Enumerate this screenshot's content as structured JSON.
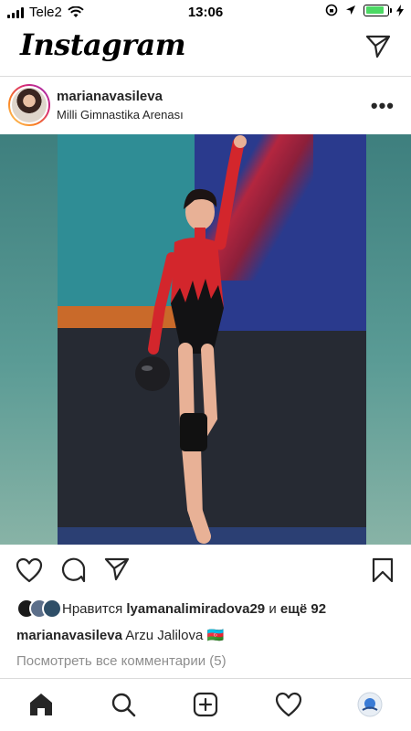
{
  "status_bar": {
    "carrier": "Tele2",
    "time": "13:06",
    "battery_level": 0.85,
    "battery_color": "#4cd964"
  },
  "header": {
    "app_title": "Instagram",
    "dm_icon": "paper-plane-icon"
  },
  "post": {
    "username": "marianavasileva",
    "location": "Milli Gimnastika Arenası",
    "more_icon": "more-horizontal-icon",
    "more_glyph": "•••",
    "likes": {
      "prefix": "Нравится",
      "user": "lyamanalimiradova29",
      "conjunction": "и",
      "others": "ещё 92"
    },
    "caption": {
      "username": "marianavasileva",
      "text": "Arzu Jalilova",
      "flag": "🇦🇿"
    },
    "view_comments": "Посмотреть все комментарии (5)"
  },
  "actions": {
    "like_icon": "heart-icon",
    "comment_icon": "comment-icon",
    "share_icon": "paper-plane-icon",
    "save_icon": "bookmark-icon"
  },
  "tabbar": {
    "items": [
      "home-icon",
      "search-icon",
      "add-post-icon",
      "activity-heart-icon",
      "profile-avatar"
    ]
  },
  "colors": {
    "text": "#262626",
    "muted": "#8e8e8e",
    "divider": "#dbdbdb",
    "story_ring": "#d62976"
  }
}
